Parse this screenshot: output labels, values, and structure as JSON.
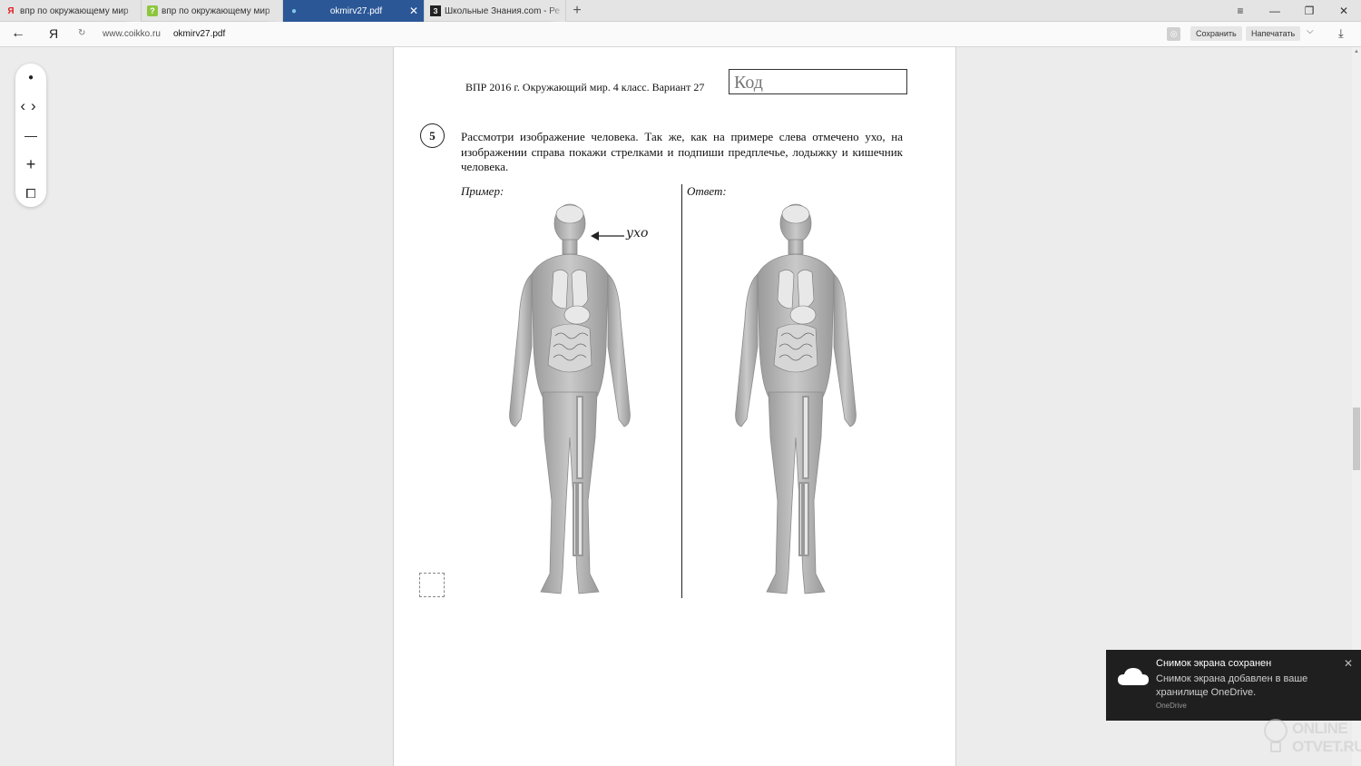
{
  "tabs": [
    {
      "title": "впр по окружающему мир",
      "favicon": "Я",
      "favicon_color": "#e01e1e",
      "active": false
    },
    {
      "title": "впр по окружающему мир",
      "favicon": "?",
      "favicon_color": "#8cc63f",
      "active": false
    },
    {
      "title": "okmirv27.pdf",
      "favicon": "●",
      "favicon_color": "#7ec8e3",
      "active": true
    },
    {
      "title": "Школьные Знания.com - Ре",
      "favicon": "З",
      "favicon_color": "#222222",
      "active": false
    }
  ],
  "tab_close": "✕",
  "new_tab": "+",
  "window_controls": {
    "menu": "≡",
    "minimize": "—",
    "restore": "❐",
    "close": "✕"
  },
  "address": {
    "back": "←",
    "yandex_logo": "Я",
    "reload": "↻",
    "domain": "www.coikko.ru",
    "path": "okmirv27.pdf",
    "save_label": "Сохранить",
    "print_label": "Напечатать",
    "more": "⌵",
    "download": "⤓"
  },
  "toolbar": {
    "dot": "●",
    "prev": "‹",
    "next": "›",
    "zoom_out": "—",
    "zoom_in": "+",
    "fit": "⧠"
  },
  "document": {
    "header": "ВПР 2016 г. Окружающий мир. 4 класс. Вариант 27",
    "code_box": "Код",
    "question_number": "5",
    "question_text": "Рассмотри изображение человека. Так же, как на примере слева отмечено ухо, на изображении справа покажи стрелками и подпиши предплечье, лодыжку и кишечник человека.",
    "example_label": "Пример:",
    "answer_label": "Ответ:",
    "ear_label": "ухо"
  },
  "toast": {
    "title": "Снимок экрана сохранен",
    "body": "Снимок экрана добавлен в ваше хранилище OneDrive.",
    "source": "OneDrive",
    "close": "✕"
  },
  "watermark": {
    "line1": "ONLINE",
    "line2": "OTVET.RU"
  },
  "colors": {
    "active_tab": "#2b5797",
    "toast_bg": "#1f1f1f",
    "body_fill": "#b8b8b8"
  }
}
